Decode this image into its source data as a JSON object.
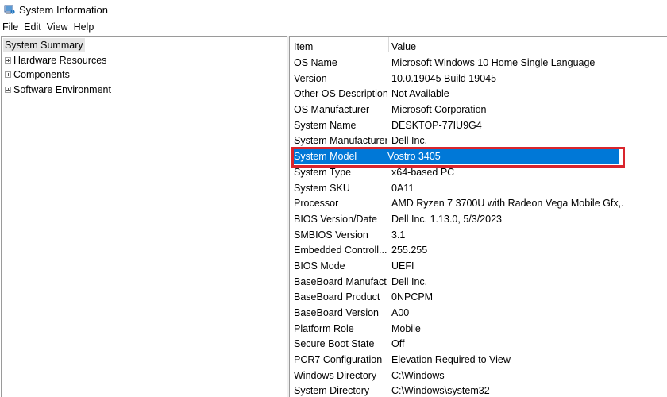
{
  "window": {
    "title": "System Information",
    "icon": "system-information-icon"
  },
  "menubar": {
    "items": [
      "File",
      "Edit",
      "View",
      "Help"
    ]
  },
  "tree": {
    "root": "System Summary",
    "children": [
      "Hardware Resources",
      "Components",
      "Software Environment"
    ]
  },
  "table": {
    "headers": {
      "item": "Item",
      "value": "Value"
    },
    "rows": [
      {
        "item": "OS Name",
        "value": "Microsoft Windows 10 Home Single Language"
      },
      {
        "item": "Version",
        "value": "10.0.19045 Build 19045"
      },
      {
        "item": "Other OS Description",
        "value": "Not Available"
      },
      {
        "item": "OS Manufacturer",
        "value": "Microsoft Corporation"
      },
      {
        "item": "System Name",
        "value": "DESKTOP-77IU9G4"
      },
      {
        "item": "System Manufacturer",
        "value": "Dell Inc."
      },
      {
        "item": "System Model",
        "value": "Vostro 3405"
      },
      {
        "item": "System Type",
        "value": "x64-based PC"
      },
      {
        "item": "System SKU",
        "value": "0A11"
      },
      {
        "item": "Processor",
        "value": "AMD Ryzen 7 3700U with Radeon Vega Mobile Gfx,..."
      },
      {
        "item": "BIOS Version/Date",
        "value": "Dell Inc. 1.13.0, 5/3/2023"
      },
      {
        "item": "SMBIOS Version",
        "value": "3.1"
      },
      {
        "item": "Embedded Controll...",
        "value": "255.255"
      },
      {
        "item": "BIOS Mode",
        "value": "UEFI"
      },
      {
        "item": "BaseBoard Manufact...",
        "value": "Dell Inc."
      },
      {
        "item": "BaseBoard Product",
        "value": "0NPCPM"
      },
      {
        "item": "BaseBoard Version",
        "value": "A00"
      },
      {
        "item": "Platform Role",
        "value": "Mobile"
      },
      {
        "item": "Secure Boot State",
        "value": "Off"
      },
      {
        "item": "PCR7 Configuration",
        "value": "Elevation Required to View"
      },
      {
        "item": "Windows Directory",
        "value": "C:\\Windows"
      },
      {
        "item": "System Directory",
        "value": "C:\\Windows\\system32"
      }
    ],
    "selected_row_item": "System Model"
  },
  "colors": {
    "selection": "#0078d7",
    "highlight_border": "#d9252d",
    "tree_root_bg": "#e5e5e5"
  }
}
